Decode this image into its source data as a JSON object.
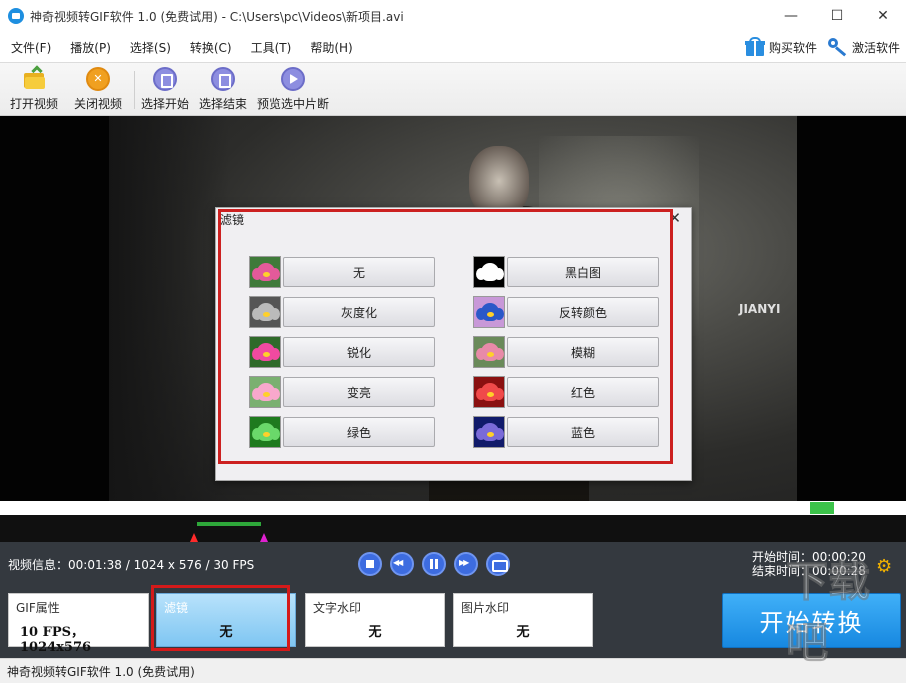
{
  "titlebar": {
    "title": "神奇视频转GIF软件 1.0 (免费试用)  -  C:\\Users\\pc\\Videos\\新项目.avi",
    "minimize": "—",
    "maximize": "☐",
    "close": "✕"
  },
  "menubar": {
    "items": [
      "文件(F)",
      "播放(P)",
      "选择(S)",
      "转换(C)",
      "工具(T)",
      "帮助(H)"
    ],
    "buy": "购买软件",
    "activate": "激活软件"
  },
  "toolbar": {
    "open": "打开视频",
    "close_video": "关闭视频",
    "select_start": "选择开始",
    "select_end": "选择结束",
    "preview": "预览选中片断"
  },
  "video": {
    "watermark": "JIANYI"
  },
  "filter_dialog": {
    "title": "滤镜",
    "close": "✕",
    "filters": [
      {
        "label": "无",
        "thumb_bg": "#3f7a3a",
        "petal": "#e35a9a"
      },
      {
        "label": "黑白图",
        "thumb_bg": "#000000",
        "petal": "#ffffff"
      },
      {
        "label": "灰度化",
        "thumb_bg": "#555555",
        "petal": "#bbbbbb"
      },
      {
        "label": "反转颜色",
        "thumb_bg": "#c898d8",
        "petal": "#2a58c8"
      },
      {
        "label": "锐化",
        "thumb_bg": "#2f6a2a",
        "petal": "#f04aa0"
      },
      {
        "label": "模糊",
        "thumb_bg": "#6a8a5a",
        "petal": "#e88aa8"
      },
      {
        "label": "变亮",
        "thumb_bg": "#7ab070",
        "petal": "#f8a8cc"
      },
      {
        "label": "红色",
        "thumb_bg": "#8a1010",
        "petal": "#f04a4a"
      },
      {
        "label": "绿色",
        "thumb_bg": "#1e7a1e",
        "petal": "#6ad86a"
      },
      {
        "label": "蓝色",
        "thumb_bg": "#101a6a",
        "petal": "#7a6ad8"
      }
    ]
  },
  "bottom": {
    "video_info": "视频信息：00:01:38 / 1024 x 576 / 30 FPS",
    "start_time": "开始时间：00:00:20",
    "end_time": "结束时间：00:00:28",
    "cards": {
      "gif": {
        "title": "GIF属性",
        "value": "10 FPS，1024x576"
      },
      "filter": {
        "title": "滤镜",
        "value": "无"
      },
      "text_wm": {
        "title": "文字水印",
        "value": "无"
      },
      "image_wm": {
        "title": "图片水印",
        "value": "无"
      }
    },
    "start_button": "开始转换"
  },
  "statusbar": {
    "text": "神奇视频转GIF软件 1.0 (免费试用)"
  },
  "corner_watermark": "下载吧",
  "colors": {
    "accent_blue": "#1788e0",
    "highlight_red": "#d41a1a",
    "panel_dark": "#34393f"
  }
}
